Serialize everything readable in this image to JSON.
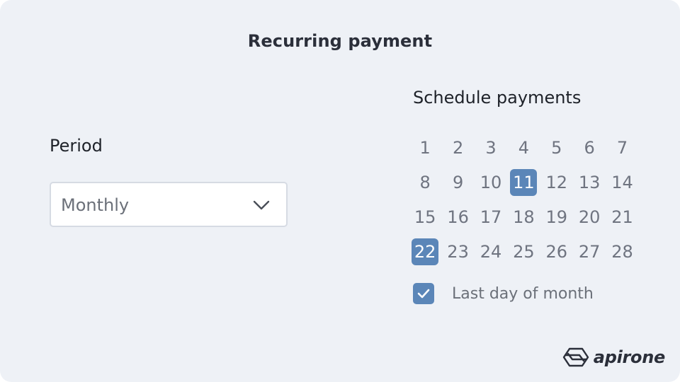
{
  "header": {
    "title": "Recurring payment"
  },
  "period": {
    "label": "Period",
    "selected": "Monthly",
    "icon": "chevron-down-icon"
  },
  "schedule": {
    "label": "Schedule payments",
    "days": [
      "1",
      "2",
      "3",
      "4",
      "5",
      "6",
      "7",
      "8",
      "9",
      "10",
      "11",
      "12",
      "13",
      "14",
      "15",
      "16",
      "17",
      "18",
      "19",
      "20",
      "21",
      "22",
      "23",
      "24",
      "25",
      "26",
      "27",
      "28"
    ],
    "selected_days": [
      "11",
      "22"
    ]
  },
  "last_day": {
    "label": "Last day of month",
    "checked": true
  },
  "brand": {
    "name": "apirone",
    "icon": "apirone-logo-icon"
  },
  "colors": {
    "accent": "#5b86b8",
    "background": "#eef1f6",
    "text": "#1e2229",
    "muted_text": "#6f7480"
  }
}
